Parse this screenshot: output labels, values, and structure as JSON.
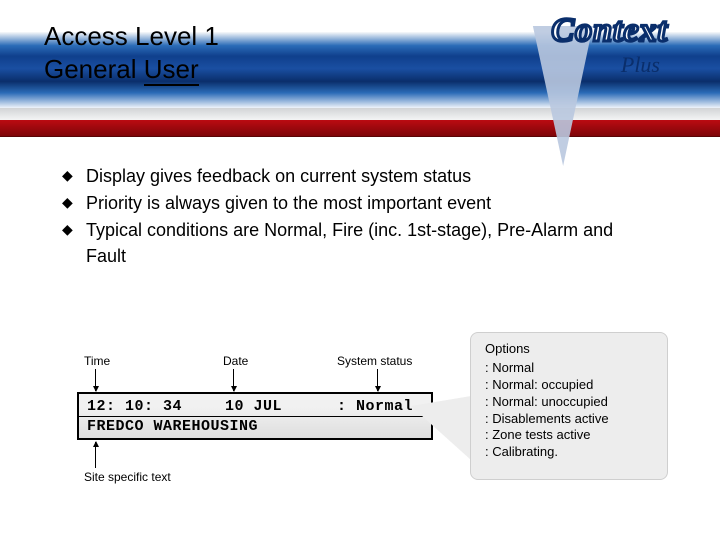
{
  "title": {
    "line1": "Access Level 1",
    "line2_left": "General ",
    "line2_underlined": "User"
  },
  "logo": {
    "brand": "Context",
    "sub": "Plus"
  },
  "bullets": [
    "Display gives feedback on current system status",
    "Priority is always given to the most important event",
    "Typical conditions are Normal, Fire (inc. 1st-stage), Pre-Alarm and  Fault"
  ],
  "labels": {
    "time": "Time",
    "date": "Date",
    "status": "System status",
    "site": "Site specific text"
  },
  "lcd": {
    "time": "12: 10: 34",
    "date": "10 JUL",
    "status": ": Normal",
    "line2": "FREDCO WAREHOUSING"
  },
  "options": {
    "header": "Options",
    "items": [
      ": Normal",
      ": Normal: occupied",
      ": Normal: unoccupied",
      ": Disablements active",
      ": Zone tests active",
      ": Calibrating."
    ]
  }
}
